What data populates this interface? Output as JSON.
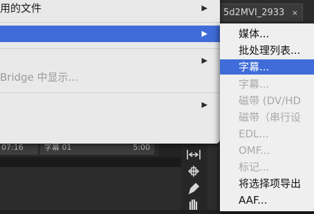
{
  "doc_tab": {
    "label": "5d2MVI_2933",
    "close": "×"
  },
  "timeline": {
    "left_clip": "07:16",
    "right_clip_name": "字幕 01",
    "right_clip_time": "5:00"
  },
  "main_menu": {
    "items": [
      {
        "label": "用的文件",
        "arrow": "▶",
        "disabled": false,
        "selected": false
      },
      {
        "label": "",
        "arrow": "▶",
        "disabled": false,
        "selected": true
      },
      {
        "label": "",
        "arrow": "▶",
        "disabled": false,
        "selected": false
      },
      {
        "label": "Bridge 中显示...",
        "arrow": "",
        "disabled": true,
        "selected": false
      },
      {
        "label": "",
        "arrow": "▶",
        "disabled": false,
        "selected": false
      }
    ]
  },
  "sub_menu": {
    "items": [
      {
        "label": "媒体...",
        "disabled": false,
        "selected": false
      },
      {
        "label": "批处理列表...",
        "disabled": false,
        "selected": false
      },
      {
        "label": "字幕...",
        "disabled": false,
        "selected": true
      },
      {
        "label": "字幕...",
        "disabled": true,
        "selected": false
      },
      {
        "label": "磁带 (DV/HD",
        "disabled": true,
        "selected": false
      },
      {
        "label": "磁带（串行设",
        "disabled": true,
        "selected": false
      },
      {
        "label": "EDL...",
        "disabled": true,
        "selected": false
      },
      {
        "label": "OMF...",
        "disabled": true,
        "selected": false
      },
      {
        "label": "标记...",
        "disabled": true,
        "selected": false
      },
      {
        "label": "将选择项导出",
        "disabled": false,
        "selected": false
      },
      {
        "label": "AAF...",
        "disabled": false,
        "selected": false
      }
    ]
  },
  "tools": {
    "icons": [
      "track-select-forward-icon",
      "rolling-edit-icon",
      "pen-icon",
      "hand-icon"
    ]
  },
  "colors": {
    "selection": "#3f6cd8",
    "menu_bg": "#e9e9e9",
    "app_bg": "#232323"
  }
}
